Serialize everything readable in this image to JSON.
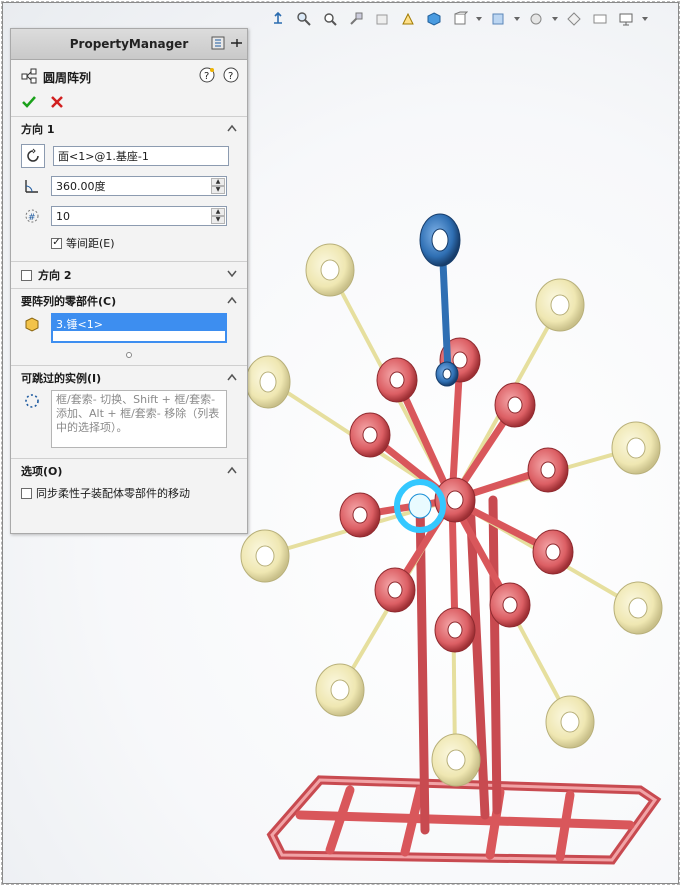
{
  "panel": {
    "title": "PropertyManager",
    "feature_name": "圆周阵列"
  },
  "direction1": {
    "header": "方向 1",
    "axis_value": "面<1>@1.基座-1",
    "angle_value": "360.00度",
    "count_value": "10",
    "equal_spacing_label": "等间距(E)",
    "equal_spacing_checked": true
  },
  "direction2": {
    "header": "方向 2",
    "checked": false
  },
  "components": {
    "header": "要阵列的零部件(C)",
    "selected_item": "3.锤<1>"
  },
  "skip": {
    "header": "可跳过的实例(I)",
    "hint": "框/套索- 切换、Shift + 框/套索- 添加、Alt + 框/套索- 移除（列表中的选择项）。"
  },
  "options": {
    "header": "选项(O)",
    "flex_label": "同步柔性子装配体零部件的移动",
    "flex_checked": false
  },
  "colors": {
    "frame_red": "#d9575b",
    "ring_yellow": "#f0eab9",
    "blue_part": "#2f6fb3",
    "selection_cyan": "#34c8ff",
    "accept_green": "#1aa11a",
    "cancel_red": "#d11f1f"
  },
  "icons": [
    "pattern-icon",
    "pin-icon",
    "help-icon",
    "help2-icon",
    "accept-icon",
    "cancel-icon",
    "axis-icon",
    "angle-icon",
    "count-icon",
    "component-icon",
    "skip-icon",
    "chevron-up-icon",
    "chevron-down-icon"
  ]
}
